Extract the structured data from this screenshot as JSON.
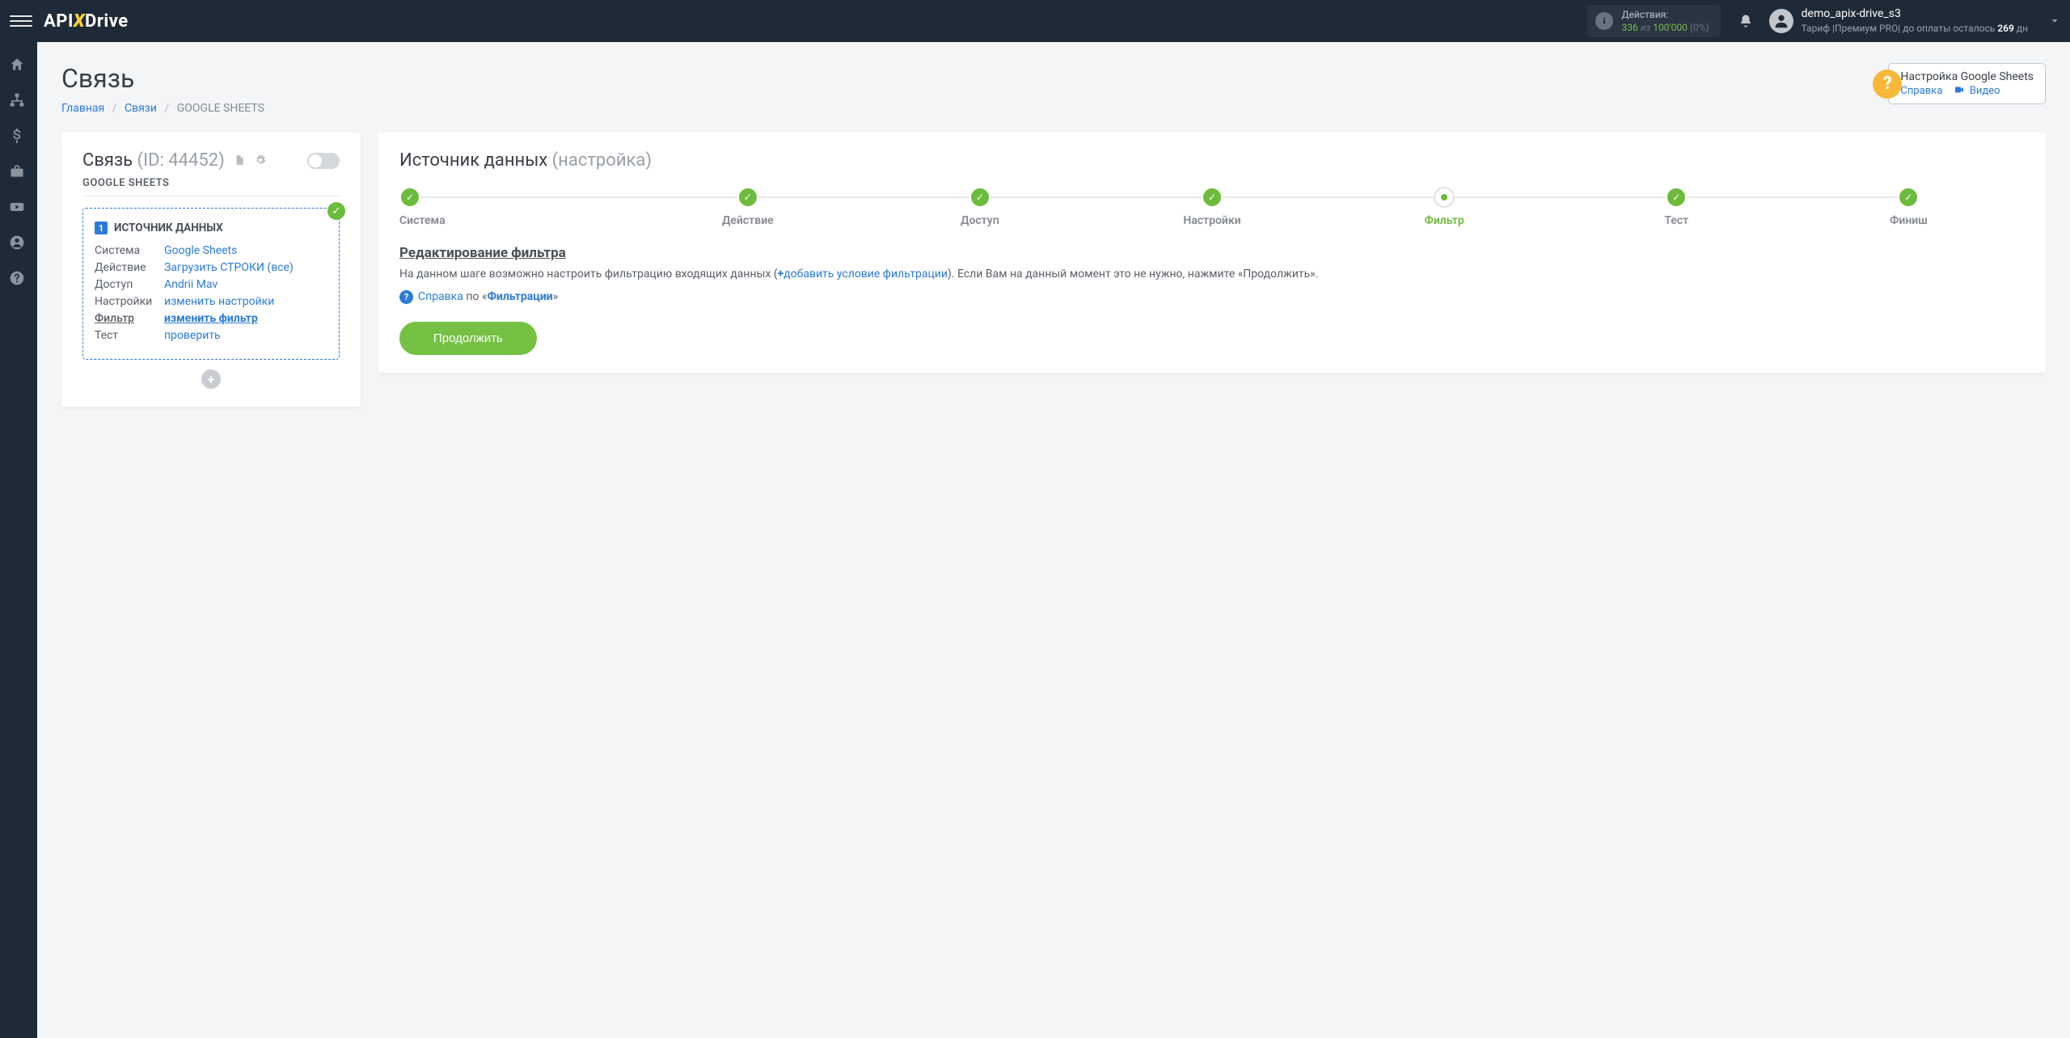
{
  "header": {
    "logo_a": "API",
    "logo_x": "X",
    "logo_b": "Drive",
    "actions_label": "Действия:",
    "actions_count": "336",
    "actions_of": "из",
    "actions_total": "100'000",
    "actions_pct": "(0%)",
    "username": "demo_apix-drive_s3",
    "tariff_a": "Тариф |Премиум PRO| до оплаты осталось ",
    "tariff_days": "269",
    "tariff_b": " дн"
  },
  "page": {
    "title": "Связь",
    "crumb_home": "Главная",
    "crumb_links": "Связи",
    "crumb_current": "GOOGLE SHEETS"
  },
  "helpbox": {
    "title": "Настройка Google Sheets",
    "link1": "Справка",
    "link2": "Видео"
  },
  "leftcard": {
    "title": "Связь",
    "id": "(ID: 44452)",
    "sub": "GOOGLE SHEETS",
    "src_label": "ИСТОЧНИК ДАННЫХ",
    "rows": [
      {
        "k": "Система",
        "v": "Google Sheets",
        "active": false
      },
      {
        "k": "Действие",
        "v": "Загрузить СТРОКИ (все)",
        "active": false
      },
      {
        "k": "Доступ",
        "v": "Andrii Mav",
        "active": false
      },
      {
        "k": "Настройки",
        "v": "изменить настройки",
        "active": false
      },
      {
        "k": "Фильтр",
        "v": "изменить фильтр",
        "active": true
      },
      {
        "k": "Тест",
        "v": "проверить",
        "active": false
      }
    ]
  },
  "rightcard": {
    "title_a": "Источник данных ",
    "title_b": "(настройка)",
    "steps": [
      "Система",
      "Действие",
      "Доступ",
      "Настройки",
      "Фильтр",
      "Тест",
      "Финиш"
    ],
    "current_step": 4,
    "edit_title": "Редактирование фильтра",
    "desc_a": "На данном шаге возможно настроить фильтрацию входящих данных (",
    "desc_plus": "+",
    "desc_link": "добавить условие фильтрации",
    "desc_b": "). Если Вам на данный момент это не нужно, нажмите «Продолжить».",
    "help_a": "Справка",
    "help_b": " по «",
    "help_link": "Фильтрации",
    "help_c": "»",
    "button": "Продолжить"
  }
}
